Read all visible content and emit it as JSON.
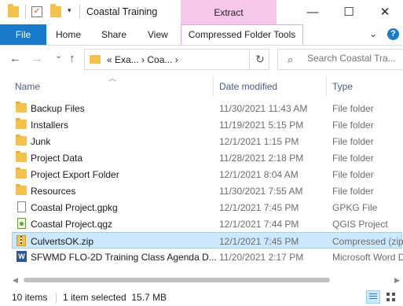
{
  "window": {
    "title": "Coastal Training",
    "contextual_tab_group": "Extract",
    "controls": {
      "minimize": "—",
      "maximize": "☐",
      "close": "✕"
    }
  },
  "ribbon": {
    "file_tab": "File",
    "tabs": [
      "Home",
      "Share",
      "View"
    ],
    "contextual_tab": "Compressed Folder Tools",
    "collapse_icon": "chevron-down-icon",
    "help_icon": "?"
  },
  "nav": {
    "back": "←",
    "forward": "→",
    "recent": "⌄",
    "up": "↑",
    "address_path": "«  Exa...  ›  Coa...  ›",
    "refresh": "↻",
    "search_placeholder": "Search Coastal Tra..."
  },
  "columns": {
    "name": "Name",
    "date": "Date modified",
    "type": "Type"
  },
  "files": [
    {
      "name": "Backup Files",
      "date": "11/30/2021 11:43 AM",
      "type": "File folder",
      "icon": "folder-icon",
      "selected": false
    },
    {
      "name": "Installers",
      "date": "11/19/2021 5:15 PM",
      "type": "File folder",
      "icon": "folder-icon",
      "selected": false
    },
    {
      "name": "Junk",
      "date": "12/1/2021 1:15 PM",
      "type": "File folder",
      "icon": "folder-icon",
      "selected": false
    },
    {
      "name": "Project Data",
      "date": "11/28/2021 2:18 PM",
      "type": "File folder",
      "icon": "folder-icon",
      "selected": false
    },
    {
      "name": "Project Export Folder",
      "date": "12/1/2021 8:04 AM",
      "type": "File folder",
      "icon": "folder-icon",
      "selected": false
    },
    {
      "name": "Resources",
      "date": "11/30/2021 7:55 AM",
      "type": "File folder",
      "icon": "folder-icon",
      "selected": false
    },
    {
      "name": "Coastal Project.gpkg",
      "date": "12/1/2021 7:45 PM",
      "type": "GPKG File",
      "icon": "document-icon",
      "selected": false
    },
    {
      "name": "Coastal Project.qgz",
      "date": "12/1/2021 7:44 PM",
      "type": "QGIS Project",
      "icon": "qgis-project-icon",
      "selected": false
    },
    {
      "name": "CulvertsOK.zip",
      "date": "12/1/2021 7:45 PM",
      "type": "Compressed (zip",
      "icon": "zip-folder-icon",
      "selected": true
    },
    {
      "name": "SFWMD FLO-2D Training Class Agenda D...",
      "date": "11/20/2021 2:17 PM",
      "type": "Microsoft Word D",
      "icon": "word-document-icon",
      "selected": false
    }
  ],
  "status": {
    "item_count": "10 items",
    "selection": "1 item selected  15.7 MB"
  },
  "colors": {
    "file_tab": "#1979ca",
    "extract_tab": "#f6c7e9",
    "selected_row": "#cce8ff",
    "folder": "#f3c24d"
  }
}
